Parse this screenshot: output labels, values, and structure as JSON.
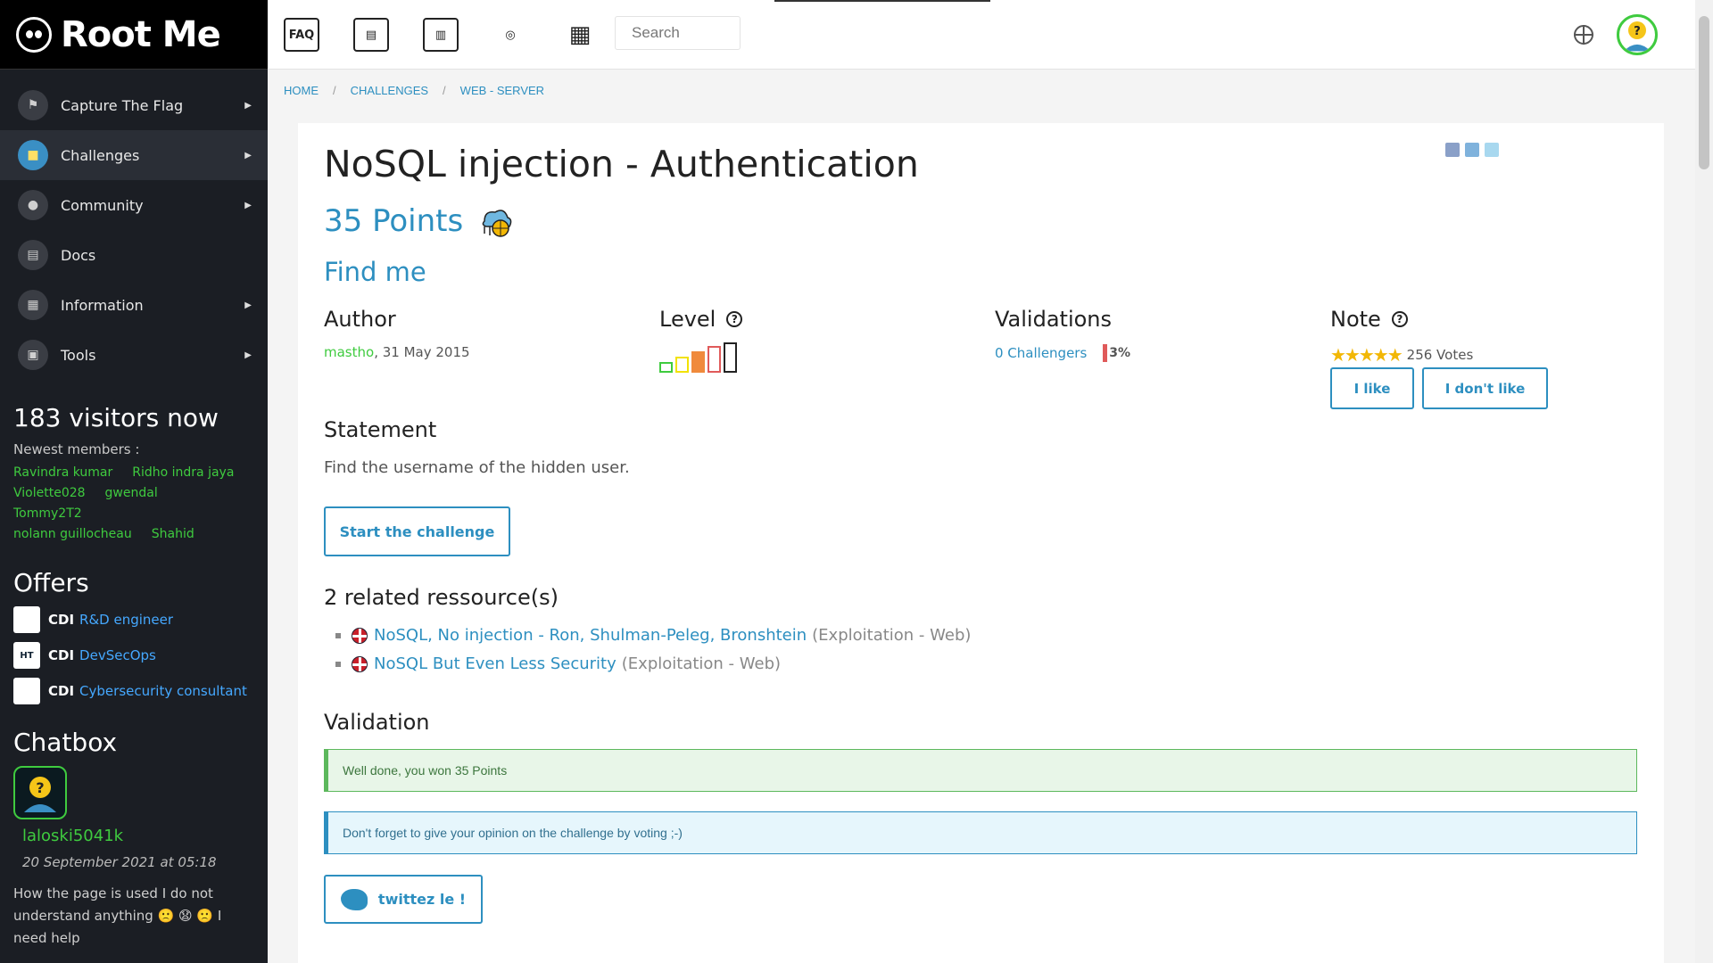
{
  "brand": {
    "name": "Root Me"
  },
  "sidebar": {
    "items": [
      {
        "label": "Capture The Flag",
        "icon": "flag-icon",
        "caret": true
      },
      {
        "label": "Challenges",
        "icon": "lock-icon",
        "caret": true
      },
      {
        "label": "Community",
        "icon": "people-icon",
        "caret": true
      },
      {
        "label": "Docs",
        "icon": "book-icon",
        "caret": false
      },
      {
        "label": "Information",
        "icon": "newspaper-icon",
        "caret": true
      },
      {
        "label": "Tools",
        "icon": "toolbox-icon",
        "caret": true
      }
    ],
    "visitors_title": "183 visitors now",
    "newest_label": "Newest members :",
    "members": [
      "Ravindra kumar",
      "Ridho indra jaya",
      "Violette028",
      "gwendal",
      "Tommy2T2",
      "nolann guillocheau",
      "Shahid"
    ],
    "offers_title": "Offers",
    "offers": [
      {
        "type": "CDI",
        "title": "R&D engineer",
        "logo": ""
      },
      {
        "type": "CDI",
        "title": "DevSecOps",
        "logo": "HT"
      },
      {
        "type": "CDI",
        "title": "Cybersecurity consultant",
        "logo": ""
      }
    ],
    "chatbox_title": "Chatbox",
    "chat": {
      "user": "laloski5041k",
      "date": "20 September 2021 at 05:18",
      "message": "How the page is used I do not understand anything 🙁 😧 🙁 I need help"
    }
  },
  "topbar": {
    "icons": [
      "faq-icon",
      "certificate-icon",
      "printer-icon",
      "radar-icon",
      "cart-icon"
    ],
    "search_placeholder": "Search",
    "language_icon": "globe-icon",
    "avatar_icon": "user-avatar-icon"
  },
  "breadcrumb": [
    "HOME",
    "CHALLENGES",
    "WEB - SERVER"
  ],
  "challenge": {
    "title": "NoSQL injection - Authentication",
    "points": "35 Points",
    "subtitle": "Find me",
    "author_label": "Author",
    "author_name": "mastho",
    "author_date": ",  31 May 2015",
    "level_label": "Level",
    "level": 3,
    "level_max": 5,
    "validations_label": "Validations",
    "validations_link": "0 Challengers",
    "validations_pct": "3%",
    "note_label": "Note",
    "stars": "★★★★★",
    "votes": "256 Votes",
    "like_label": "I like",
    "dislike_label": "I don't like",
    "statement_label": "Statement",
    "statement": "Find the username of the hidden user.",
    "start_label": "Start the challenge",
    "resources_label": "2 related ressource(s)",
    "resources": [
      {
        "title": "NoSQL, No injection - Ron, Shulman-Peleg, Bronshtein",
        "category": "(Exploitation - Web)"
      },
      {
        "title": "NoSQL But Even Less Security",
        "category": "(Exploitation - Web)"
      }
    ],
    "validation_label": "Validation",
    "success_msg": "Well done, you won 35 Points",
    "info_msg": "Don't forget to give your opinion on the challenge by voting ;-)",
    "tweet_label": "twittez le !"
  },
  "colors": {
    "accent": "#2d8fc0",
    "member": "#3fcb3f",
    "sidebar": "#1b1e24"
  }
}
